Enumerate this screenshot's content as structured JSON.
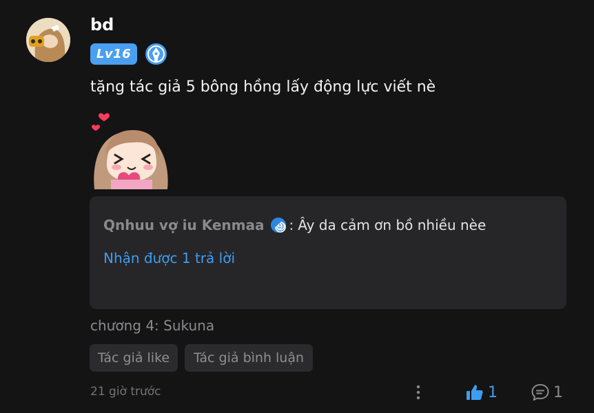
{
  "comment": {
    "username": "bd",
    "level": "Lv16",
    "text": "tặng tác giả 5 bông hồng lấy động lực viết nè",
    "chapter": "chương 4: Sukuna",
    "time": "21 giờ trước",
    "like_count": "1",
    "reply_count": "1"
  },
  "reply": {
    "author": "Qnhuu vợ iu Kenmaa",
    "separator": ":",
    "text": "Ây da cảm ơn bồ nhiều nèe",
    "view_replies": "Nhận được 1 trả lời"
  },
  "tags": {
    "author_like": "Tác giả like",
    "author_reply": "Tác giả bình luận"
  },
  "icons": [
    "avatar",
    "pen-badge-icon",
    "sticker",
    "spiral-icon",
    "more-icon",
    "thumbs-up-icon",
    "comment-icon"
  ],
  "colors": {
    "background": "#141415",
    "accent": "#3d9ef0",
    "badge": "#4a9ff0",
    "reply_box": "#262628",
    "chip": "#2b2b2d"
  }
}
